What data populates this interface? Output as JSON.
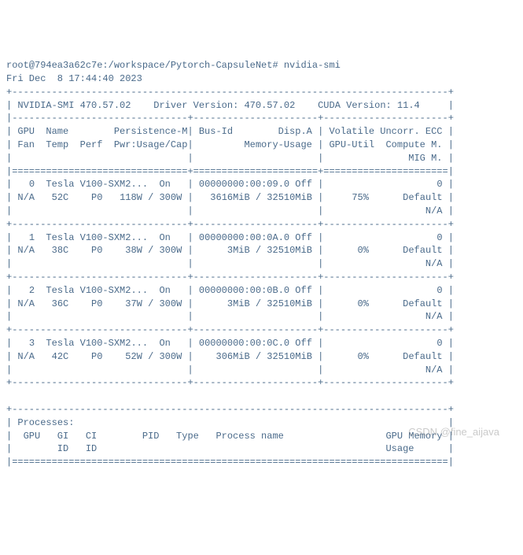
{
  "prompt": "root@794ea3a62c7e:/workspace/Pytorch-CapsuleNet# nvidia-smi",
  "timestamp": "Fri Dec  8 17:44:40 2023",
  "header": {
    "smi_version_label": "NVIDIA-SMI",
    "smi_version": "470.57.02",
    "driver_label": "Driver Version:",
    "driver_version": "470.57.02",
    "cuda_label": "CUDA Version:",
    "cuda_version": "11.4"
  },
  "col_headers": {
    "line1": "| GPU  Name        Persistence-M| Bus-Id        Disp.A | Volatile Uncorr. ECC |",
    "line2": "| Fan  Temp  Perf  Pwr:Usage/Cap|         Memory-Usage | GPU-Util  Compute M. |",
    "line3": "|                               |                      |               MIG M. |"
  },
  "gpus": [
    {
      "idx": "0",
      "name": "Tesla V100-SXM2...",
      "persist": "On",
      "busid": "00000000:00:09.0",
      "dispa": "Off",
      "fan": "N/A",
      "temp": "52C",
      "perf": "P0",
      "pwr": "118W / 300W",
      "mem": "3616MiB / 32510MiB",
      "util": "75%",
      "compute": "Default",
      "ecc": "0",
      "mig": "N/A"
    },
    {
      "idx": "1",
      "name": "Tesla V100-SXM2...",
      "persist": "On",
      "busid": "00000000:00:0A.0",
      "dispa": "Off",
      "fan": "N/A",
      "temp": "38C",
      "perf": "P0",
      "pwr": "38W / 300W",
      "mem": "3MiB / 32510MiB",
      "util": "0%",
      "compute": "Default",
      "ecc": "0",
      "mig": "N/A"
    },
    {
      "idx": "2",
      "name": "Tesla V100-SXM2...",
      "persist": "On",
      "busid": "00000000:00:0B.0",
      "dispa": "Off",
      "fan": "N/A",
      "temp": "36C",
      "perf": "P0",
      "pwr": "37W / 300W",
      "mem": "3MiB / 32510MiB",
      "util": "0%",
      "compute": "Default",
      "ecc": "0",
      "mig": "N/A"
    },
    {
      "idx": "3",
      "name": "Tesla V100-SXM2...",
      "persist": "On",
      "busid": "00000000:00:0C.0",
      "dispa": "Off",
      "fan": "N/A",
      "temp": "42C",
      "perf": "P0",
      "pwr": "52W / 300W",
      "mem": "306MiB / 32510MiB",
      "util": "0%",
      "compute": "Default",
      "ecc": "0",
      "mig": "N/A"
    }
  ],
  "processes": {
    "title": "Processes:",
    "header1": "|  GPU   GI   CI        PID   Type   Process name                  GPU Memory |",
    "header2": "|        ID   ID                                                   Usage      |"
  },
  "watermark": "CSDN @fine_aijava"
}
